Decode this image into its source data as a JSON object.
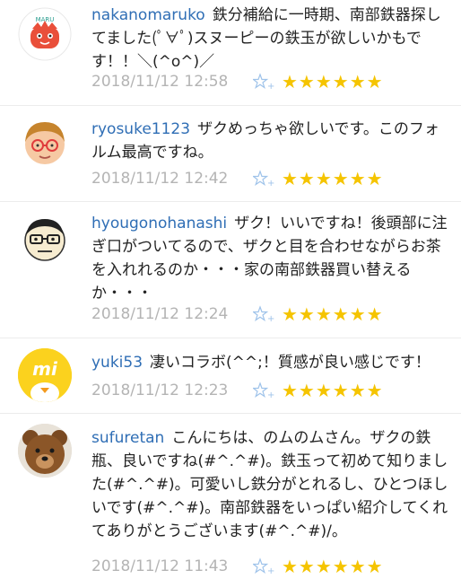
{
  "comments": [
    {
      "username": "nakanomaruko",
      "text": "鉄分補給に一時期、南部鉄器探してました(ﾟ∀ﾟ)スヌーピーの鉄玉が欲しいかもです！！＼(^o^)／",
      "timestamp": "2018/11/12 12:58",
      "stars": "★★★★★★",
      "avatar_text": "MARU"
    },
    {
      "username": "ryosuke1123",
      "text": "ザクめっちゃ欲しいです。このフォルム最高ですね。",
      "timestamp": "2018/11/12 12:42",
      "stars": "★★★★★★"
    },
    {
      "username": "hyougonohanashi",
      "text": "ザク！いいですね！後頭部に注ぎ口がついてるので、ザクと目を合わせながらお茶を入れれるのか・・・家の南部鉄器買い替えるか・・・",
      "timestamp": "2018/11/12 12:24",
      "stars": "★★★★★★"
    },
    {
      "username": "yuki53",
      "text": "凄いコラボ(^^;！質感が良い感じです！",
      "timestamp": "2018/11/12 12:23",
      "stars": "★★★★★★",
      "avatar_text": "mi"
    },
    {
      "username": "sufuretan",
      "text": "こんにちは、のムのムさん。ザクの鉄瓶、良いですね(#^.^#)。鉄玉って初めて知りました(#^.^#)。可愛いし鉄分がとれるし、ひとつほしいです(#^.^#)。南部鉄器をいっぱい紹介してくれてありがとうございます(#^.^#)/。",
      "timestamp": "2018/11/12 11:43",
      "stars": "★★★★★★"
    }
  ],
  "colors": {
    "username": "#2f6eb5",
    "timestamp": "#b4b4b4",
    "star": "#f5c400"
  }
}
